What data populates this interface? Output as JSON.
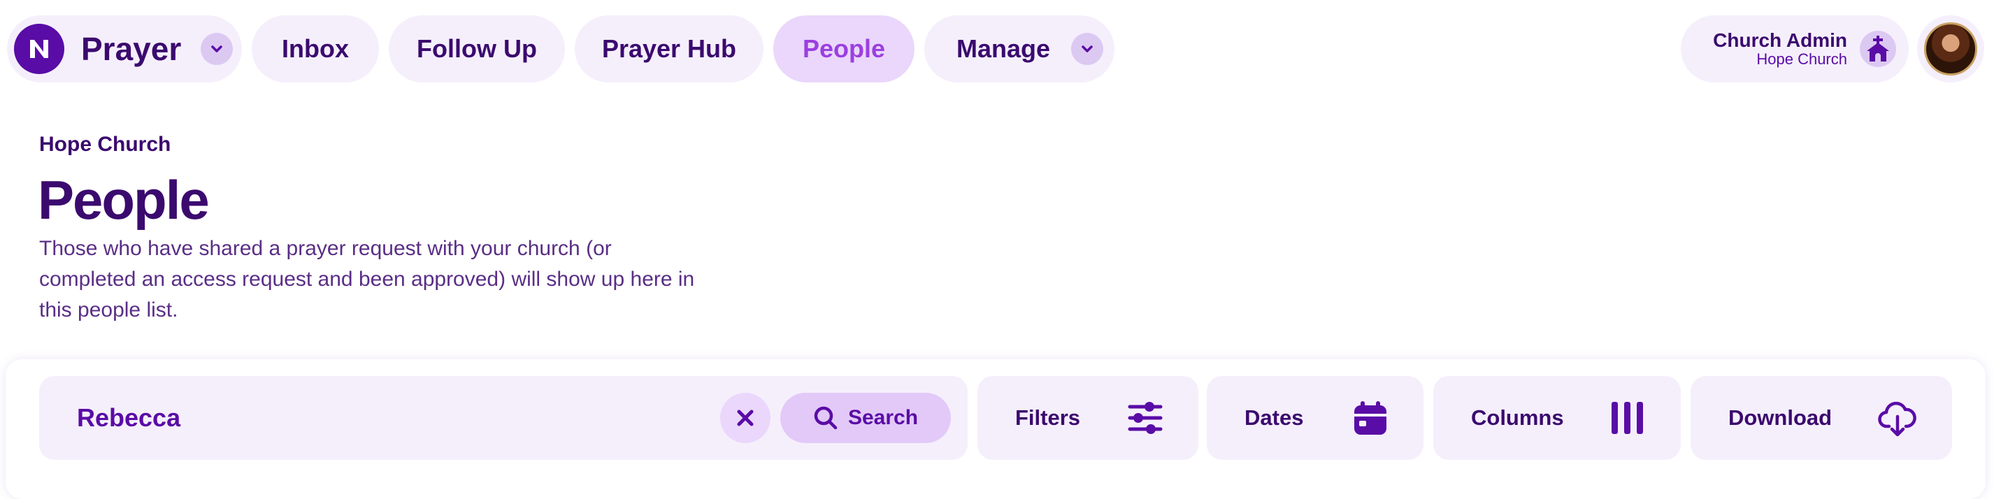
{
  "brand": {
    "name": "Prayer",
    "logo_icon": "logo-icon"
  },
  "nav": {
    "tabs": [
      {
        "label": "Inbox"
      },
      {
        "label": "Follow Up"
      },
      {
        "label": "Prayer Hub"
      },
      {
        "label": "People",
        "active": true
      },
      {
        "label": "Manage",
        "has_dropdown": true
      }
    ]
  },
  "user": {
    "role": "Church Admin",
    "church": "Hope Church",
    "icon": "church-icon"
  },
  "header": {
    "org": "Hope Church",
    "title": "People",
    "description": "Those who have shared a prayer request with your church (or completed an access request and been approved) will show up here in this people list."
  },
  "toolbar": {
    "search_value": "Rebecca",
    "search_label": "Search",
    "filters_label": "Filters",
    "dates_label": "Dates",
    "columns_label": "Columns",
    "download_label": "Download"
  },
  "colors": {
    "accent": "#5a0ca6",
    "text": "#3b0a6e",
    "pill_bg": "#f5effc",
    "active_tab_bg": "#ead7fb",
    "active_tab_text": "#9b3fe0"
  }
}
